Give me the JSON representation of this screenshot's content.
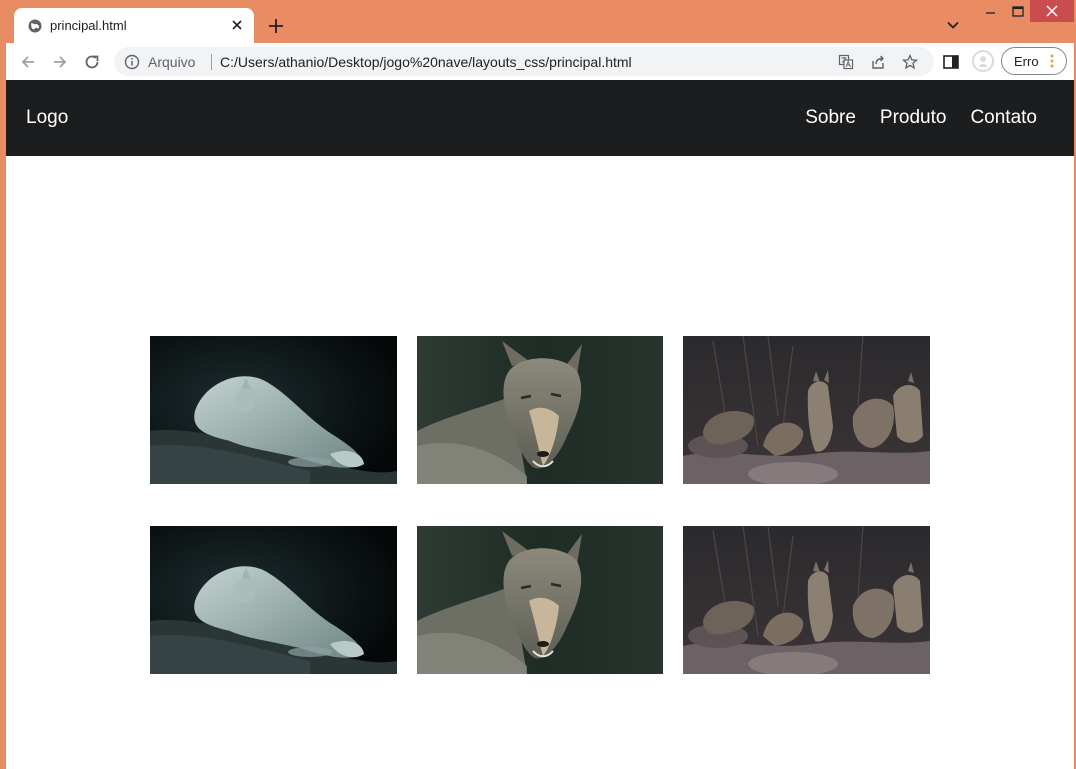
{
  "browser": {
    "tab_title": "principal.html",
    "omnibox_scheme": "Arquivo",
    "url": "C:/Users/athanio/Desktop/jogo%20nave/layouts_css/principal.html",
    "error_label": "Erro",
    "colors": {
      "frame": "#e98c63",
      "close_hover": "#c94d4f",
      "menu_dots": "#e8a23a"
    }
  },
  "site": {
    "logo": "Logo",
    "nav": [
      "Sobre",
      "Produto",
      "Contato"
    ],
    "header_bg": "#1c1d1f",
    "gallery": [
      {
        "subject": "white-wolf-resting"
      },
      {
        "subject": "grey-wolf-portrait"
      },
      {
        "subject": "wolf-pack"
      },
      {
        "subject": "white-wolf-resting"
      },
      {
        "subject": "grey-wolf-portrait"
      },
      {
        "subject": "wolf-pack"
      }
    ]
  }
}
